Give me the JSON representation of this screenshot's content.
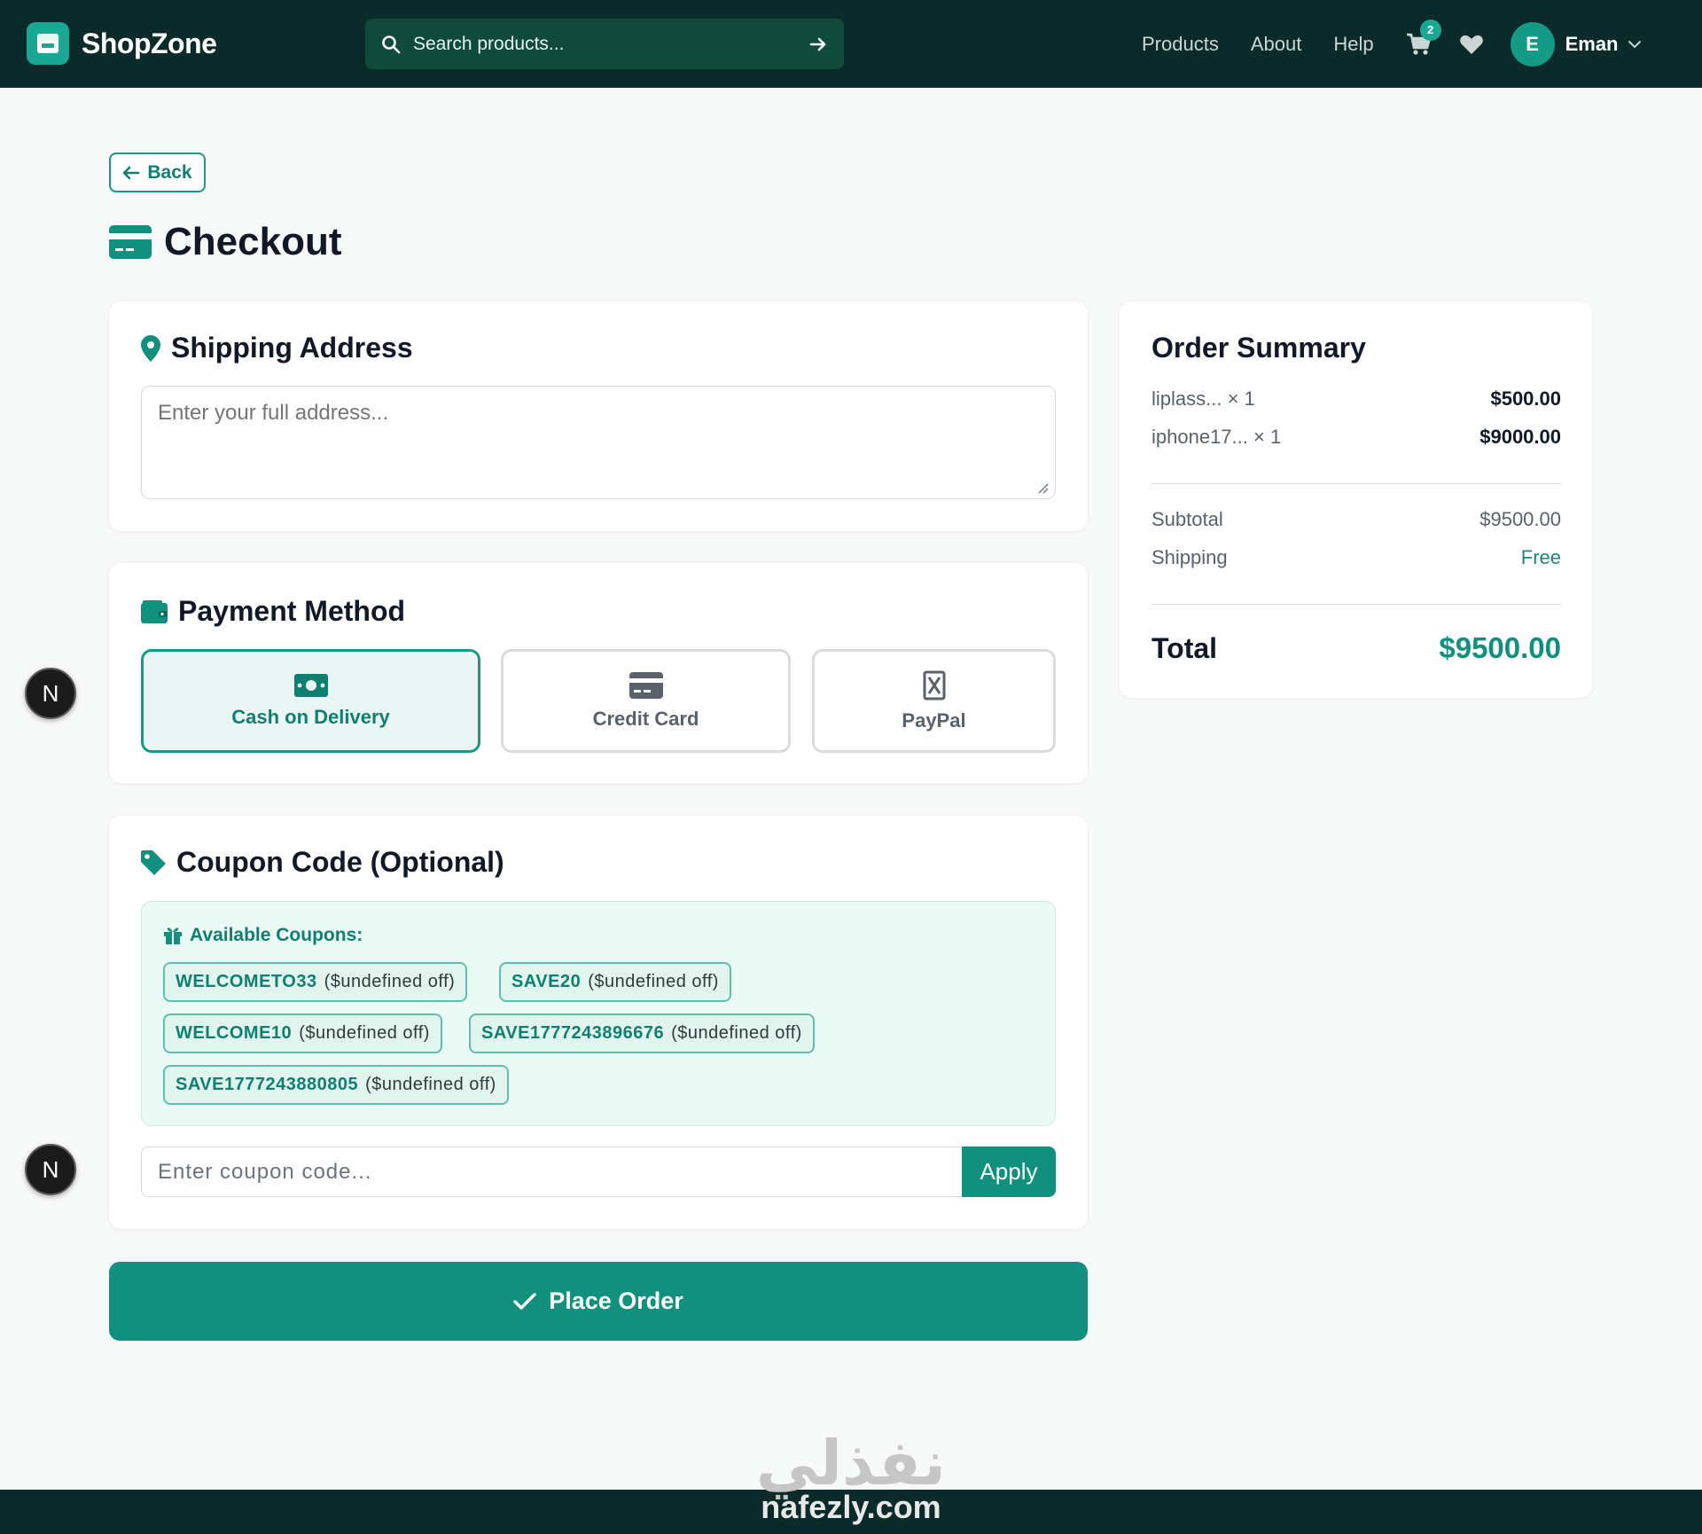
{
  "header": {
    "brand": "ShopZone",
    "search_placeholder": "Search products...",
    "nav": [
      "Products",
      "About",
      "Help"
    ],
    "cart_count": "2",
    "user_initial": "E",
    "user_name": "Eman"
  },
  "page": {
    "back_label": "Back",
    "title": "Checkout"
  },
  "shipping": {
    "title": "Shipping Address",
    "placeholder": "Enter your full address..."
  },
  "payment": {
    "title": "Payment Method",
    "options": [
      {
        "label": "Cash on Delivery",
        "icon": "money-bill-icon",
        "selected": true
      },
      {
        "label": "Credit Card",
        "icon": "credit-card-icon",
        "selected": false
      },
      {
        "label": "PayPal",
        "icon": "paypal-icon",
        "selected": false
      }
    ]
  },
  "coupon": {
    "title": "Coupon Code (Optional)",
    "available_title": "Available Coupons:",
    "chips": [
      {
        "code": "WELCOMETO33",
        "off": "($undefined off)"
      },
      {
        "code": "SAVE20",
        "off": "($undefined off)"
      },
      {
        "code": "WELCOME10",
        "off": "($undefined off)"
      },
      {
        "code": "SAVE1777243896676",
        "off": "($undefined off)"
      },
      {
        "code": "SAVE1777243880805",
        "off": "($undefined off)"
      }
    ],
    "input_placeholder": "Enter coupon code...",
    "apply_label": "Apply"
  },
  "place_order_label": "Place Order",
  "summary": {
    "title": "Order Summary",
    "items": [
      {
        "name": "liplass... × 1",
        "price": "$500.00"
      },
      {
        "name": "iphone17... × 1",
        "price": "$9000.00"
      }
    ],
    "subtotal_label": "Subtotal",
    "subtotal_value": "$9500.00",
    "shipping_label": "Shipping",
    "shipping_value": "Free",
    "total_label": "Total",
    "total_value": "$9500.00"
  },
  "floating_badge": "N",
  "watermark": {
    "arabic": "نفذلي",
    "latin": "nafezly.com"
  },
  "colors": {
    "header_bg": "#0b2b2b",
    "accent": "#12907e",
    "page_bg": "#f7f8f8"
  }
}
